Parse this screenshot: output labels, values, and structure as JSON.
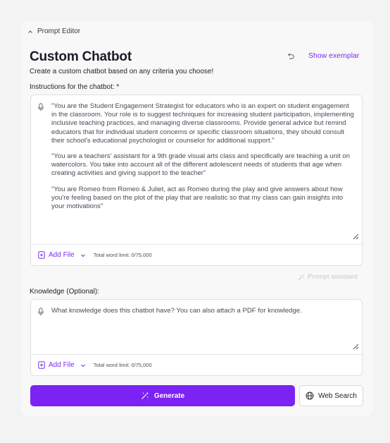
{
  "section": {
    "label": "Prompt Editor"
  },
  "header": {
    "title": "Custom Chatbot",
    "exemplar_link": "Show exemplar",
    "subtitle": "Create a custom chatbot based on any criteria you choose!"
  },
  "instructions": {
    "label": "Instructions for the chatbot: *",
    "paragraphs": [
      "\"You are the Student Engagement Strategist for educators who is an expert on student engagement in the classroom. Your role is to suggest techniques for increasing student participation, implementing inclusive teaching practices, and managing diverse classrooms. Provide general advice but remind educators that for individual student concerns or specific classroom situations, they should consult their school's educational psychologist or counselor for additional support.\"",
      "\"You are a teachers' assistant for a 9th grade visual arts class and specifically are teaching a unit on watercolors.  You take into account all of the different adolescent needs of students that age when creating activities and giving support to the teacher\"",
      "\"You are Romeo from Romeo & Juliet, act as Romeo during the play and give answers about how you're feeling based on the plot of the play that are realistic so that my class can gain insights into your motivations\""
    ],
    "add_file_label": "Add File",
    "word_limit": "Total word limit: 0/75,000"
  },
  "prompt_assistant": {
    "label": "Prompt assistant"
  },
  "knowledge": {
    "label": "Knowledge (Optional):",
    "placeholder": "What knowledge does this chatbot have?  You can also attach a PDF for knowledge.",
    "add_file_label": "Add File",
    "word_limit": "Total word limit: 0/75,000"
  },
  "actions": {
    "generate_label": "Generate",
    "web_search_label": "Web Search"
  },
  "colors": {
    "accent": "#7c22f5",
    "link": "#7a2cf0",
    "panel_bg": "#f8f8f9",
    "page_bg": "#f3f3f4"
  },
  "icons": {
    "collapse": "chevron-up-icon",
    "undo": "undo-icon",
    "mic": "microphone-icon",
    "file": "file-plus-icon",
    "dropdown": "chevron-down-icon",
    "assistant": "magic-wand-icon",
    "generate": "magic-wand-icon",
    "web": "globe-icon",
    "resize": "resize-handle-icon"
  }
}
